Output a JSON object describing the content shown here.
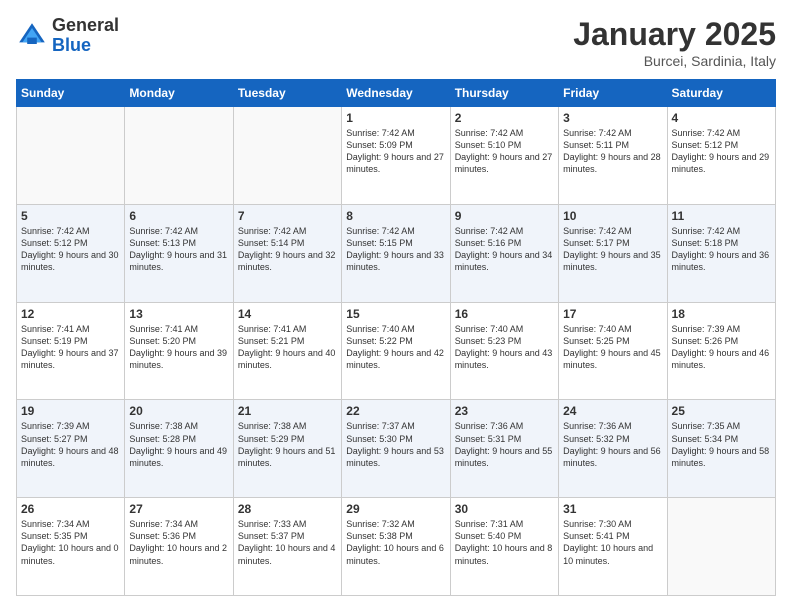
{
  "logo": {
    "general": "General",
    "blue": "Blue"
  },
  "title": "January 2025",
  "location": "Burcei, Sardinia, Italy",
  "headers": [
    "Sunday",
    "Monday",
    "Tuesday",
    "Wednesday",
    "Thursday",
    "Friday",
    "Saturday"
  ],
  "weeks": [
    [
      {
        "day": "",
        "empty": true
      },
      {
        "day": "",
        "empty": true
      },
      {
        "day": "",
        "empty": true
      },
      {
        "day": "1",
        "sunrise": "Sunrise: 7:42 AM",
        "sunset": "Sunset: 5:09 PM",
        "daylight": "Daylight: 9 hours and 27 minutes."
      },
      {
        "day": "2",
        "sunrise": "Sunrise: 7:42 AM",
        "sunset": "Sunset: 5:10 PM",
        "daylight": "Daylight: 9 hours and 27 minutes."
      },
      {
        "day": "3",
        "sunrise": "Sunrise: 7:42 AM",
        "sunset": "Sunset: 5:11 PM",
        "daylight": "Daylight: 9 hours and 28 minutes."
      },
      {
        "day": "4",
        "sunrise": "Sunrise: 7:42 AM",
        "sunset": "Sunset: 5:12 PM",
        "daylight": "Daylight: 9 hours and 29 minutes."
      }
    ],
    [
      {
        "day": "5",
        "sunrise": "Sunrise: 7:42 AM",
        "sunset": "Sunset: 5:12 PM",
        "daylight": "Daylight: 9 hours and 30 minutes."
      },
      {
        "day": "6",
        "sunrise": "Sunrise: 7:42 AM",
        "sunset": "Sunset: 5:13 PM",
        "daylight": "Daylight: 9 hours and 31 minutes."
      },
      {
        "day": "7",
        "sunrise": "Sunrise: 7:42 AM",
        "sunset": "Sunset: 5:14 PM",
        "daylight": "Daylight: 9 hours and 32 minutes."
      },
      {
        "day": "8",
        "sunrise": "Sunrise: 7:42 AM",
        "sunset": "Sunset: 5:15 PM",
        "daylight": "Daylight: 9 hours and 33 minutes."
      },
      {
        "day": "9",
        "sunrise": "Sunrise: 7:42 AM",
        "sunset": "Sunset: 5:16 PM",
        "daylight": "Daylight: 9 hours and 34 minutes."
      },
      {
        "day": "10",
        "sunrise": "Sunrise: 7:42 AM",
        "sunset": "Sunset: 5:17 PM",
        "daylight": "Daylight: 9 hours and 35 minutes."
      },
      {
        "day": "11",
        "sunrise": "Sunrise: 7:42 AM",
        "sunset": "Sunset: 5:18 PM",
        "daylight": "Daylight: 9 hours and 36 minutes."
      }
    ],
    [
      {
        "day": "12",
        "sunrise": "Sunrise: 7:41 AM",
        "sunset": "Sunset: 5:19 PM",
        "daylight": "Daylight: 9 hours and 37 minutes."
      },
      {
        "day": "13",
        "sunrise": "Sunrise: 7:41 AM",
        "sunset": "Sunset: 5:20 PM",
        "daylight": "Daylight: 9 hours and 39 minutes."
      },
      {
        "day": "14",
        "sunrise": "Sunrise: 7:41 AM",
        "sunset": "Sunset: 5:21 PM",
        "daylight": "Daylight: 9 hours and 40 minutes."
      },
      {
        "day": "15",
        "sunrise": "Sunrise: 7:40 AM",
        "sunset": "Sunset: 5:22 PM",
        "daylight": "Daylight: 9 hours and 42 minutes."
      },
      {
        "day": "16",
        "sunrise": "Sunrise: 7:40 AM",
        "sunset": "Sunset: 5:23 PM",
        "daylight": "Daylight: 9 hours and 43 minutes."
      },
      {
        "day": "17",
        "sunrise": "Sunrise: 7:40 AM",
        "sunset": "Sunset: 5:25 PM",
        "daylight": "Daylight: 9 hours and 45 minutes."
      },
      {
        "day": "18",
        "sunrise": "Sunrise: 7:39 AM",
        "sunset": "Sunset: 5:26 PM",
        "daylight": "Daylight: 9 hours and 46 minutes."
      }
    ],
    [
      {
        "day": "19",
        "sunrise": "Sunrise: 7:39 AM",
        "sunset": "Sunset: 5:27 PM",
        "daylight": "Daylight: 9 hours and 48 minutes."
      },
      {
        "day": "20",
        "sunrise": "Sunrise: 7:38 AM",
        "sunset": "Sunset: 5:28 PM",
        "daylight": "Daylight: 9 hours and 49 minutes."
      },
      {
        "day": "21",
        "sunrise": "Sunrise: 7:38 AM",
        "sunset": "Sunset: 5:29 PM",
        "daylight": "Daylight: 9 hours and 51 minutes."
      },
      {
        "day": "22",
        "sunrise": "Sunrise: 7:37 AM",
        "sunset": "Sunset: 5:30 PM",
        "daylight": "Daylight: 9 hours and 53 minutes."
      },
      {
        "day": "23",
        "sunrise": "Sunrise: 7:36 AM",
        "sunset": "Sunset: 5:31 PM",
        "daylight": "Daylight: 9 hours and 55 minutes."
      },
      {
        "day": "24",
        "sunrise": "Sunrise: 7:36 AM",
        "sunset": "Sunset: 5:32 PM",
        "daylight": "Daylight: 9 hours and 56 minutes."
      },
      {
        "day": "25",
        "sunrise": "Sunrise: 7:35 AM",
        "sunset": "Sunset: 5:34 PM",
        "daylight": "Daylight: 9 hours and 58 minutes."
      }
    ],
    [
      {
        "day": "26",
        "sunrise": "Sunrise: 7:34 AM",
        "sunset": "Sunset: 5:35 PM",
        "daylight": "Daylight: 10 hours and 0 minutes."
      },
      {
        "day": "27",
        "sunrise": "Sunrise: 7:34 AM",
        "sunset": "Sunset: 5:36 PM",
        "daylight": "Daylight: 10 hours and 2 minutes."
      },
      {
        "day": "28",
        "sunrise": "Sunrise: 7:33 AM",
        "sunset": "Sunset: 5:37 PM",
        "daylight": "Daylight: 10 hours and 4 minutes."
      },
      {
        "day": "29",
        "sunrise": "Sunrise: 7:32 AM",
        "sunset": "Sunset: 5:38 PM",
        "daylight": "Daylight: 10 hours and 6 minutes."
      },
      {
        "day": "30",
        "sunrise": "Sunrise: 7:31 AM",
        "sunset": "Sunset: 5:40 PM",
        "daylight": "Daylight: 10 hours and 8 minutes."
      },
      {
        "day": "31",
        "sunrise": "Sunrise: 7:30 AM",
        "sunset": "Sunset: 5:41 PM",
        "daylight": "Daylight: 10 hours and 10 minutes."
      },
      {
        "day": "",
        "empty": true
      }
    ]
  ]
}
